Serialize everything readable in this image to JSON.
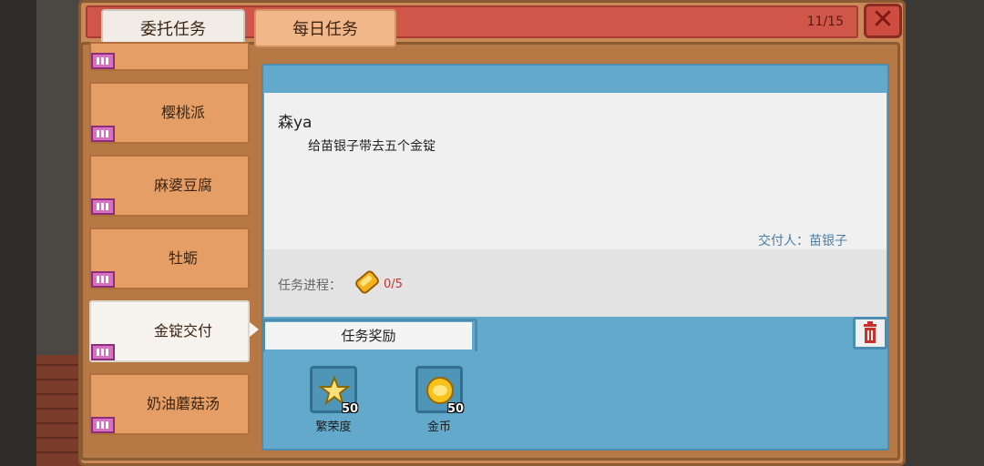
{
  "tabs": {
    "commission": "委托任务",
    "daily": "每日任务"
  },
  "counter": "11/15",
  "close_icon": "✕",
  "quest_list": [
    {
      "label": "樱桃派"
    },
    {
      "label": "麻婆豆腐"
    },
    {
      "label": "牡蛎"
    },
    {
      "label": "金锭交付"
    },
    {
      "label": "奶油蘑菇汤"
    }
  ],
  "detail": {
    "requester": "森ya",
    "description": "给苗银子带去五个金锭",
    "deliverer_label": "交付人：",
    "deliverer_name": "苗银子",
    "progress_label": "任务进程：",
    "progress_value": "0/5",
    "progress_item_icon": "gold-ingot-icon"
  },
  "rewards": {
    "tab_label": "任务奖励",
    "items": [
      {
        "name": "繁荣度",
        "amount": "50",
        "icon": "star-icon"
      },
      {
        "name": "金币",
        "amount": "50",
        "icon": "gold-coin-icon"
      }
    ]
  },
  "colors": {
    "frame": "#c98a57",
    "topbar": "#d1564a",
    "panel": "#62a9cc",
    "progress_value": "#d42f2f",
    "deliverer": "#4a7fa5"
  }
}
